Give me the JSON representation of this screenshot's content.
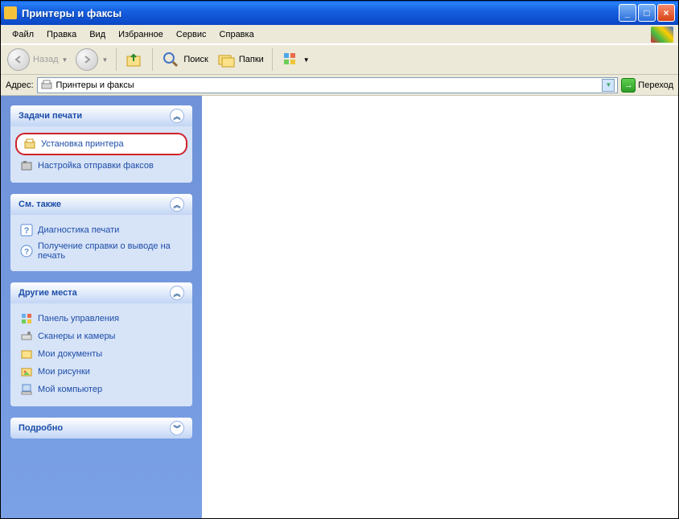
{
  "window_title": "Принтеры и факсы",
  "menu": {
    "file": "Файл",
    "edit": "Правка",
    "view": "Вид",
    "favorites": "Избранное",
    "tools": "Сервис",
    "help": "Справка"
  },
  "toolbar": {
    "back": "Назад",
    "search": "Поиск",
    "folders": "Папки"
  },
  "address": {
    "label": "Адрес:",
    "value": "Принтеры и факсы",
    "go": "Переход"
  },
  "panels": {
    "print_tasks": {
      "title": "Задачи печати",
      "install": "Установка принтера",
      "fax": "Настройка отправки факсов"
    },
    "see_also": {
      "title": "См. также",
      "diag": "Диагностика печати",
      "help": "Получение справки о выводе на печать"
    },
    "other_places": {
      "title": "Другие места",
      "cp": "Панель управления",
      "scan": "Сканеры и камеры",
      "docs": "Мои документы",
      "pics": "Мои рисунки",
      "comp": "Мой компьютер"
    },
    "details": {
      "title": "Подробно"
    }
  }
}
